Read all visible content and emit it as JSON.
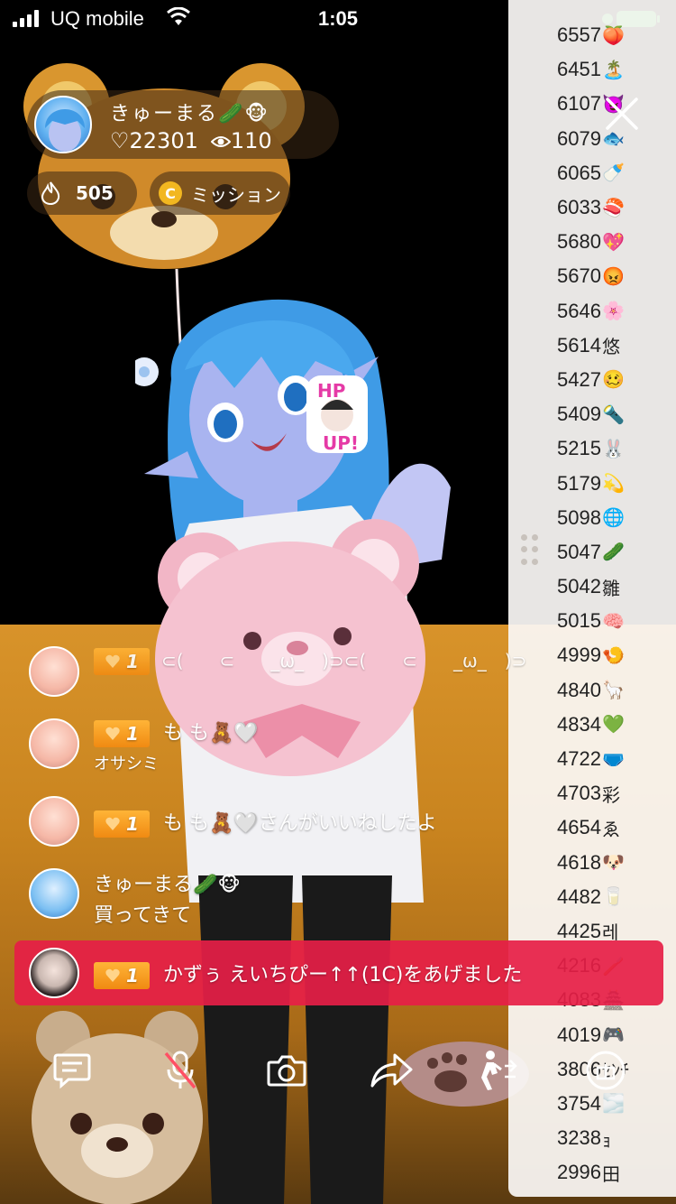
{
  "status_bar": {
    "carrier": "UQ mobile",
    "time": "1:05"
  },
  "streamer": {
    "name": "きゅーまる🥒🐵",
    "likes": "♡22301",
    "viewers": "110"
  },
  "fire_count": "505",
  "mission_label": "ミッション",
  "coin_symbol": "C",
  "sticker": {
    "top": "HP",
    "bottom": "UP!"
  },
  "leaderboard": [
    {
      "score": "6557",
      "emoji": "🍑"
    },
    {
      "score": "6451",
      "emoji": "🏝️"
    },
    {
      "score": "6107",
      "emoji": "😈"
    },
    {
      "score": "6079",
      "emoji": "🐟"
    },
    {
      "score": "6065",
      "emoji": "🍼"
    },
    {
      "score": "6033",
      "emoji": "🍣"
    },
    {
      "score": "5680",
      "emoji": "💖"
    },
    {
      "score": "5670",
      "emoji": "😡"
    },
    {
      "score": "5646",
      "emoji": "🌸"
    },
    {
      "score": "5614",
      "emoji": "悠"
    },
    {
      "score": "5427",
      "emoji": "🥴"
    },
    {
      "score": "5409",
      "emoji": "🔦"
    },
    {
      "score": "5215",
      "emoji": "🐰"
    },
    {
      "score": "5179",
      "emoji": "💫"
    },
    {
      "score": "5098",
      "emoji": "🌐"
    },
    {
      "score": "5047",
      "emoji": "🥒"
    },
    {
      "score": "5042",
      "emoji": "雛"
    },
    {
      "score": "5015",
      "emoji": "🧠"
    },
    {
      "score": "4999",
      "emoji": "🍤"
    },
    {
      "score": "4840",
      "emoji": "🦙"
    },
    {
      "score": "4834",
      "emoji": "💚"
    },
    {
      "score": "4722",
      "emoji": "🩲"
    },
    {
      "score": "4703",
      "emoji": "彩"
    },
    {
      "score": "4654",
      "emoji": "ゑ"
    },
    {
      "score": "4618",
      "emoji": "🐶"
    },
    {
      "score": "4482",
      "emoji": "🥛"
    },
    {
      "score": "4425",
      "emoji": "레"
    },
    {
      "score": "4216",
      "emoji": "🪥"
    },
    {
      "score": "4083",
      "emoji": "🏯"
    },
    {
      "score": "4019",
      "emoji": "🎮"
    },
    {
      "score": "3806",
      "emoji": "ｾﾝﾁ"
    },
    {
      "score": "3754",
      "emoji": "🌫️"
    },
    {
      "score": "3238",
      "emoji": "ｮ"
    },
    {
      "score": "2996",
      "emoji": "田"
    }
  ],
  "chat": {
    "msg1": {
      "level": "1",
      "text": "⊂(　　⊂　　_ω_　)⊃⊂(　　⊂　　_ω_　)⊃"
    },
    "msg2": {
      "level": "1",
      "text": "も も🧸🤍",
      "sub": "オサシミ"
    },
    "msg3": {
      "level": "1",
      "text": "も も🧸🤍さんがいいねしたよ"
    },
    "msg4": {
      "name": "きゅーまる🥒🐵",
      "text": "買ってきて"
    },
    "gift": {
      "level": "1",
      "text": "かずぅ えいちぴー↑↑(1C)をあげました"
    }
  }
}
